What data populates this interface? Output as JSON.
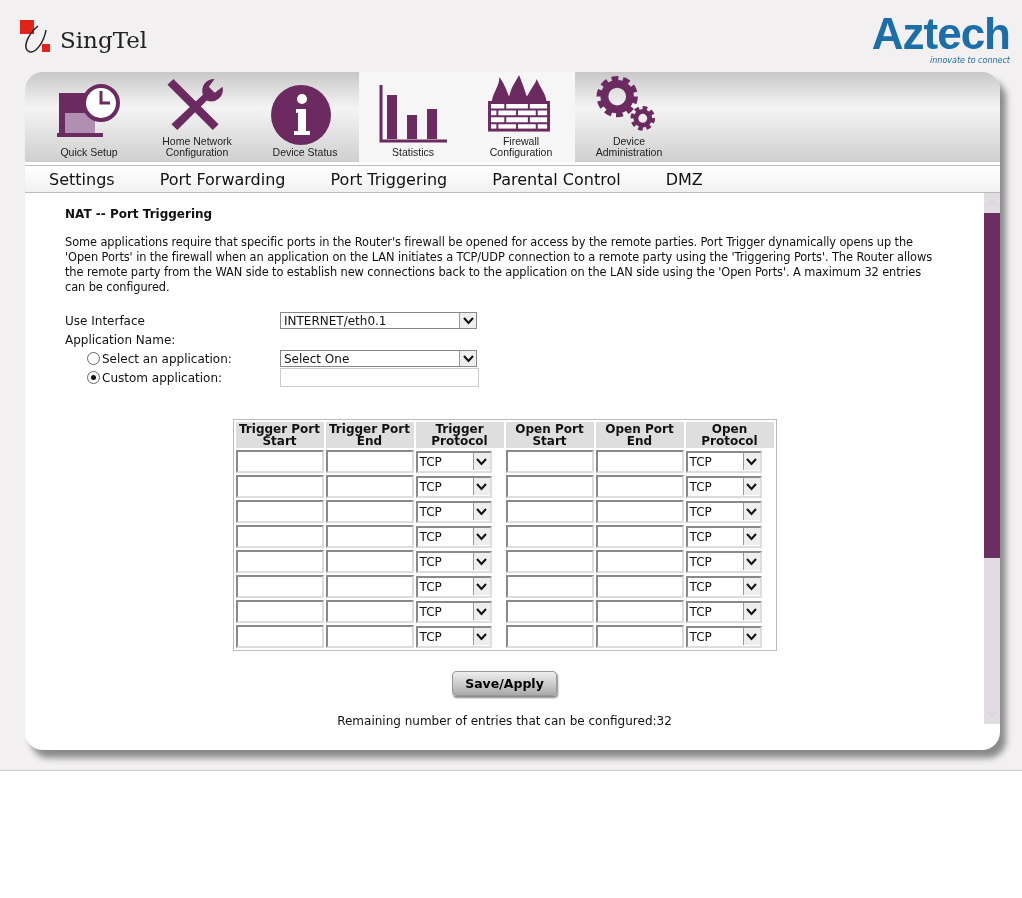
{
  "header": {
    "brand_left": "SingTel",
    "brand_right": "Aztech",
    "tagline": "innovate to connect"
  },
  "main_tabs": [
    {
      "label": "Quick Setup",
      "kind": "clock",
      "selected": false
    },
    {
      "label": "Home Network Configuration",
      "kind": "tools",
      "selected": false
    },
    {
      "label": "Device Status",
      "kind": "info",
      "selected": false
    },
    {
      "label": "Statistics",
      "kind": "chart",
      "selected": true
    },
    {
      "label": "Firewall Configuration",
      "kind": "firewall",
      "selected": true
    },
    {
      "label": "Device Administration",
      "kind": "gears",
      "selected": false
    }
  ],
  "sub_tabs": [
    "Settings",
    "Port Forwarding",
    "Port Triggering",
    "Parental Control",
    "DMZ"
  ],
  "page": {
    "title": "NAT -- Port Triggering",
    "description": "Some applications require that specific ports in the Router's firewall be opened for access by the remote parties. Port Trigger dynamically opens up the 'Open Ports' in the firewall when an application on the LAN initiates a TCP/UDP connection to a remote party using the 'Triggering Ports'. The Router allows the remote party from the WAN side to establish new connections back to the application on the LAN side using the 'Open Ports'. A maximum 32 entries can be configured.",
    "interface_label": "Use Interface",
    "interface_value": "INTERNET/eth0.1",
    "app_name_label": "Application Name:",
    "app_options": [
      {
        "label": "Select an application:",
        "kind": "select",
        "value": "Select One",
        "selected": false
      },
      {
        "label": "Custom application:",
        "kind": "text",
        "selected": true
      }
    ]
  },
  "table": {
    "columns": [
      "Trigger Port Start",
      "Trigger Port End",
      "Trigger Protocol",
      "Open Port Start",
      "Open Port End",
      "Open Protocol"
    ],
    "rows": [
      {
        "trigger_protocol": "TCP",
        "open_protocol": "TCP"
      },
      {
        "trigger_protocol": "TCP",
        "open_protocol": "TCP"
      },
      {
        "trigger_protocol": "TCP",
        "open_protocol": "TCP"
      },
      {
        "trigger_protocol": "TCP",
        "open_protocol": "TCP"
      },
      {
        "trigger_protocol": "TCP",
        "open_protocol": "TCP"
      },
      {
        "trigger_protocol": "TCP",
        "open_protocol": "TCP"
      },
      {
        "trigger_protocol": "TCP",
        "open_protocol": "TCP"
      },
      {
        "trigger_protocol": "TCP",
        "open_protocol": "TCP"
      }
    ]
  },
  "save_button": "Save/Apply",
  "remaining": "Remaining number of entries that can be configured:32"
}
